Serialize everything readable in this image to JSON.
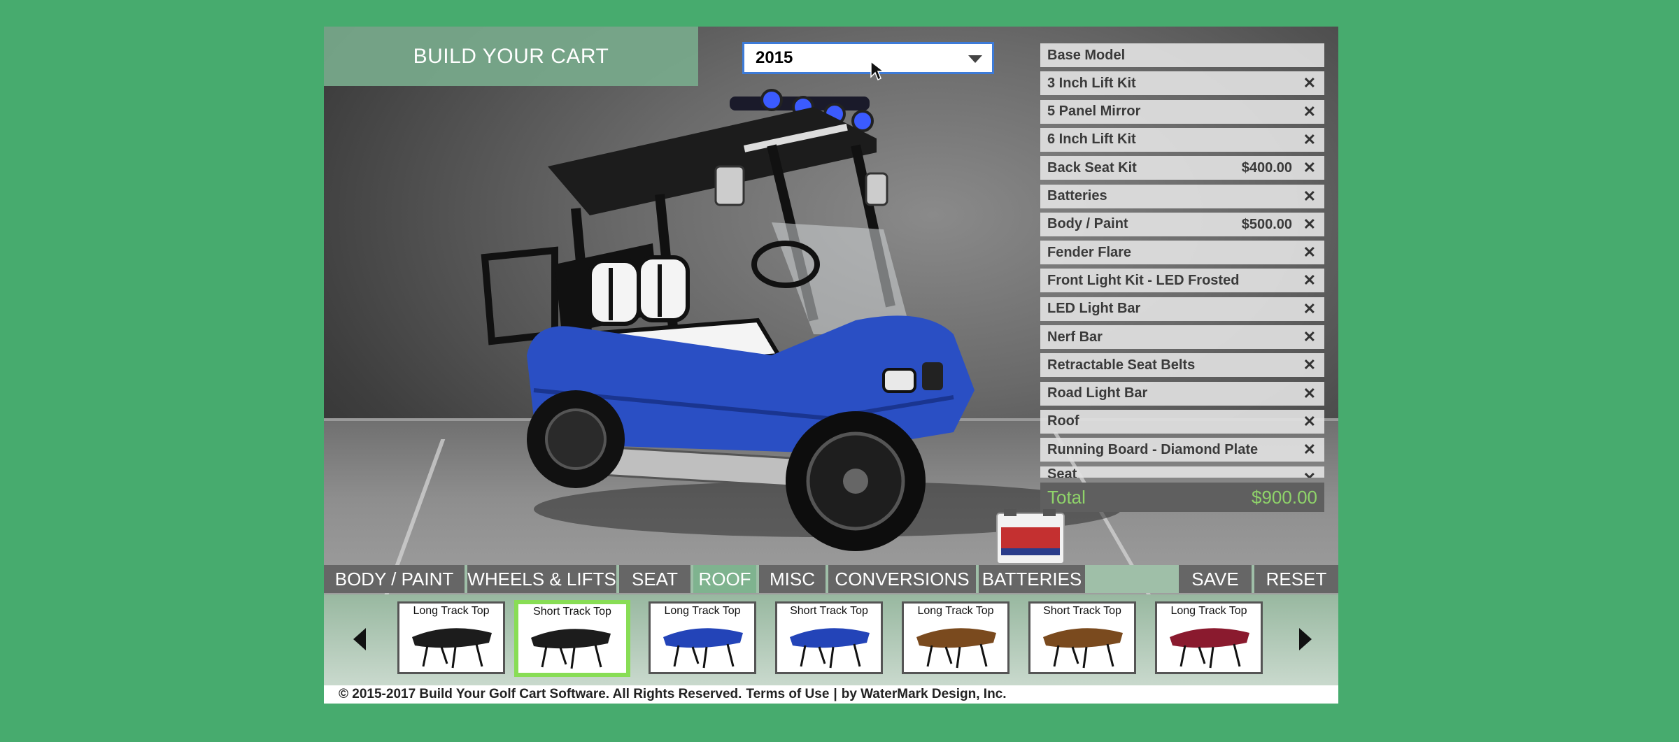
{
  "header": {
    "title": "BUILD YOUR CART"
  },
  "year_select": {
    "value": "2015"
  },
  "options": [
    {
      "name": "Base Model",
      "price": "",
      "removable": false
    },
    {
      "name": "3 Inch Lift Kit",
      "price": "",
      "removable": true
    },
    {
      "name": "5 Panel Mirror",
      "price": "",
      "removable": true
    },
    {
      "name": "6 Inch Lift Kit",
      "price": "",
      "removable": true
    },
    {
      "name": "Back Seat Kit",
      "price": "$400.00",
      "removable": true
    },
    {
      "name": "Batteries",
      "price": "",
      "removable": true
    },
    {
      "name": "Body / Paint",
      "price": "$500.00",
      "removable": true
    },
    {
      "name": "Fender Flare",
      "price": "",
      "removable": true
    },
    {
      "name": "Front Light Kit - LED Frosted",
      "price": "",
      "removable": true
    },
    {
      "name": "LED Light Bar",
      "price": "",
      "removable": true
    },
    {
      "name": "Nerf Bar",
      "price": "",
      "removable": true
    },
    {
      "name": "Retractable Seat Belts",
      "price": "",
      "removable": true
    },
    {
      "name": "Road Light Bar",
      "price": "",
      "removable": true
    },
    {
      "name": "Roof",
      "price": "",
      "removable": true
    },
    {
      "name": "Running Board - Diamond Plate",
      "price": "",
      "removable": true
    },
    {
      "name": "Seat",
      "price": "",
      "removable": true
    }
  ],
  "remove_glyph": "✕",
  "total": {
    "label": "Total",
    "amount": "$900.00"
  },
  "tabs": [
    "BODY / PAINT",
    "WHEELS & LIFTS",
    "SEAT",
    "ROOF",
    "MISC",
    "CONVERSIONS",
    "BATTERIES"
  ],
  "active_tab": "ROOF",
  "actions": {
    "save": "SAVE",
    "reset": "RESET"
  },
  "roof_thumbnails": [
    {
      "label": "Long Track Top",
      "color": "#1c1c1c"
    },
    {
      "label": "Short Track Top",
      "color": "#1c1c1c",
      "selected": true
    },
    {
      "label": "Long Track Top",
      "color": "#2344b8"
    },
    {
      "label": "Short Track Top",
      "color": "#2344b8"
    },
    {
      "label": "Long Track Top",
      "color": "#7a4a1e"
    },
    {
      "label": "Short Track Top",
      "color": "#7a4a1e"
    },
    {
      "label": "Long Track Top",
      "color": "#8a1a2e"
    }
  ],
  "footer": {
    "copyright": "© 2015-2017 Build Your Golf Cart Software. All Rights Reserved.",
    "terms": "Terms of Use",
    "separator": "|",
    "credit": "by WaterMark Design, Inc."
  },
  "colors": {
    "background": "#47ab6e",
    "accent_green": "#8fd36a",
    "cart_blue": "#2a4fc4"
  }
}
